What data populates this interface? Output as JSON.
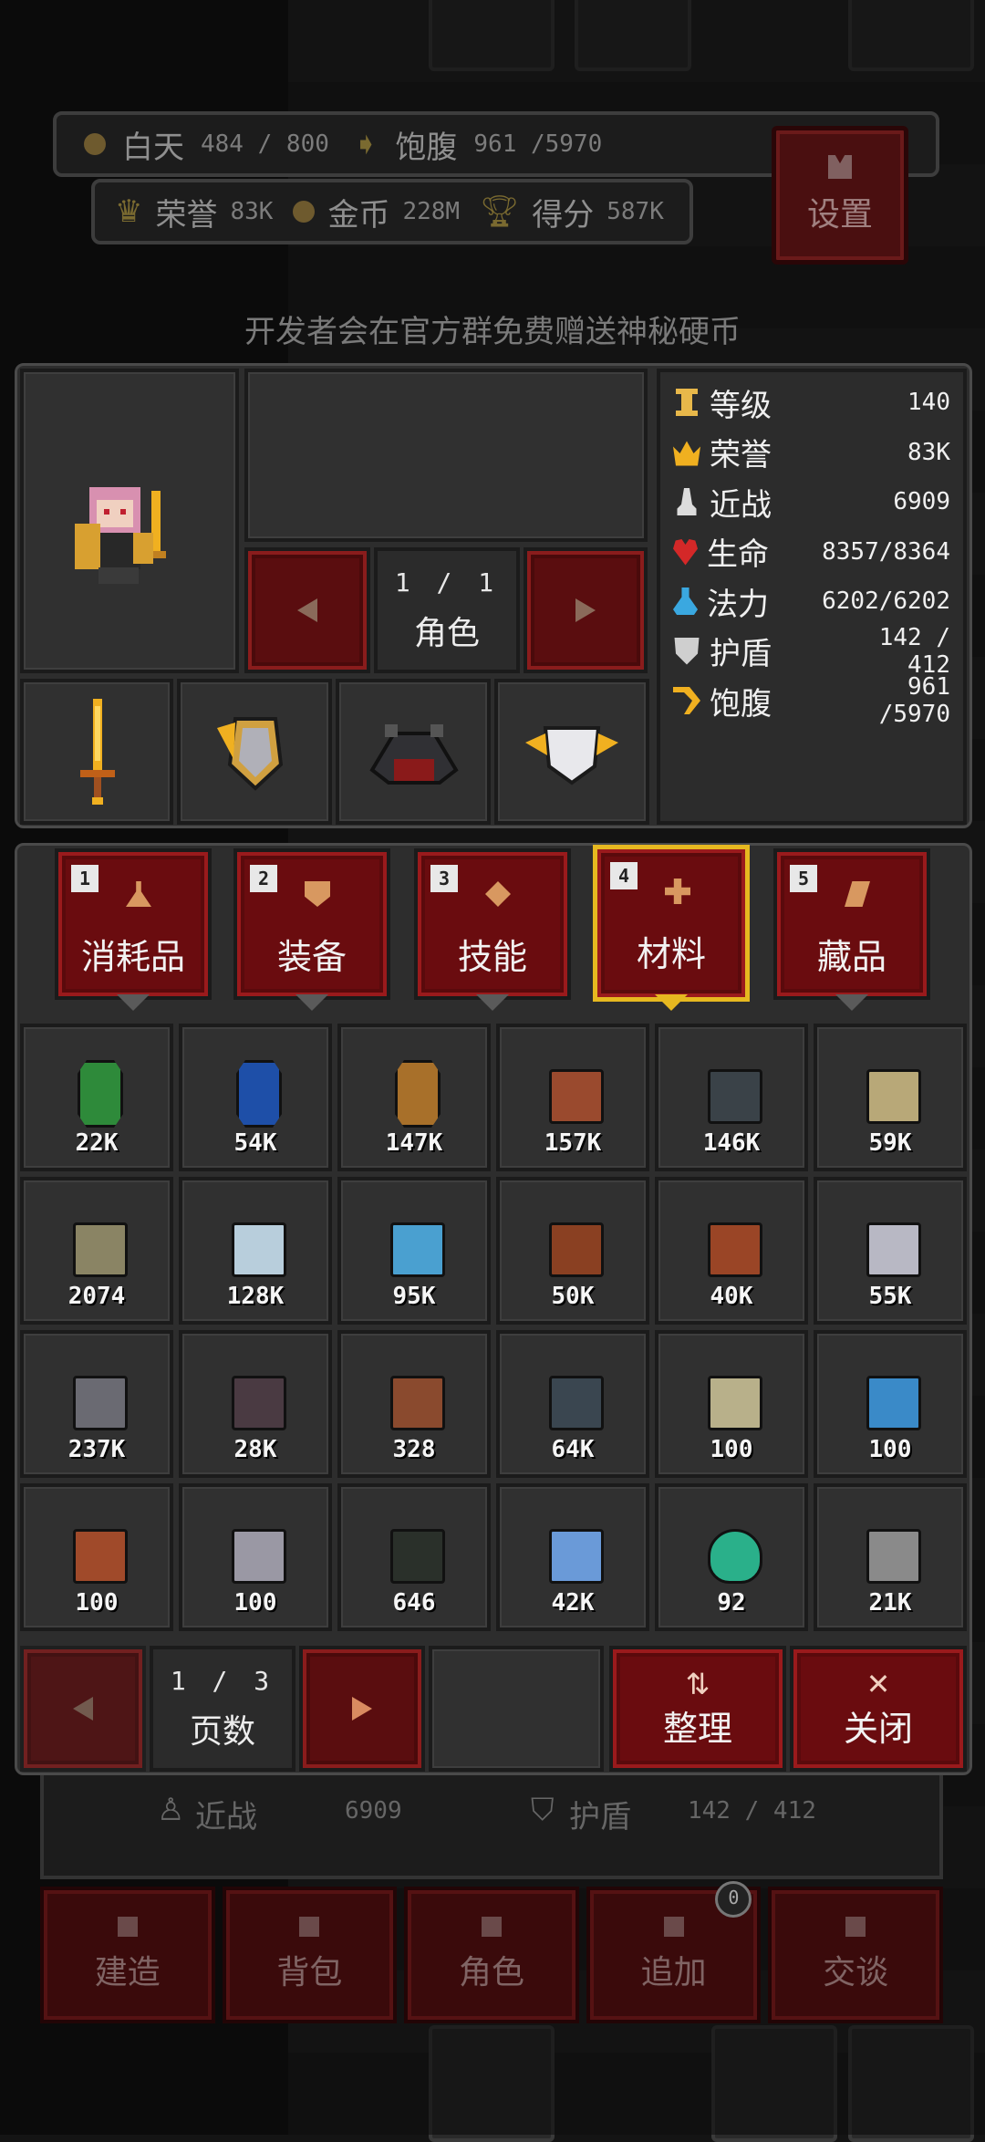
{
  "hud": {
    "day_label": "白天",
    "day_value": "484 / 800",
    "satiety_label": "饱腹",
    "satiety_value": "961 /5970",
    "honor_label": "荣誉",
    "honor_value": "83K",
    "gold_label": "金币",
    "gold_value": "228M",
    "score_label": "得分",
    "score_value": "587K",
    "settings_label": "设置"
  },
  "notice": "开发者会在官方群免费赠送神秘硬币",
  "character": {
    "page": "1 / 1",
    "page_label": "角色"
  },
  "stats": [
    {
      "label": "等级",
      "value": "140",
      "icon": "level-icon",
      "color": "#e8b84a"
    },
    {
      "label": "荣誉",
      "value": "83K",
      "icon": "crown-icon",
      "color": "#f0b020"
    },
    {
      "label": "近战",
      "value": "6909",
      "icon": "melee-icon",
      "color": "#dcdcdc"
    },
    {
      "label": "生命",
      "value": "8357/8364",
      "icon": "heart-icon",
      "color": "#d42828"
    },
    {
      "label": "法力",
      "value": "6202/6202",
      "icon": "mana-potion-icon",
      "color": "#3aa8e0"
    },
    {
      "label": "护盾",
      "value": "142 / 412",
      "icon": "shield-icon",
      "color": "#cfcfcf"
    },
    {
      "label": "饱腹",
      "value": "961 /5970",
      "icon": "satiety-icon",
      "color": "#f0b020"
    }
  ],
  "tabs": [
    {
      "num": "1",
      "label": "消耗品",
      "active": false
    },
    {
      "num": "2",
      "label": "装备",
      "active": false
    },
    {
      "num": "3",
      "label": "技能",
      "active": false
    },
    {
      "num": "4",
      "label": "材料",
      "active": true
    },
    {
      "num": "5",
      "label": "藏品",
      "active": false
    }
  ],
  "inventory": [
    {
      "count": "22K",
      "color": "#2e8a3a",
      "shape": "gem"
    },
    {
      "count": "54K",
      "color": "#1e4fa8",
      "shape": "gem"
    },
    {
      "count": "147K",
      "color": "#a8702a",
      "shape": "gem"
    },
    {
      "count": "157K",
      "color": "#9a4a2e",
      "shape": "block"
    },
    {
      "count": "146K",
      "color": "#3a4248",
      "shape": "block"
    },
    {
      "count": "59K",
      "color": "#b8a878",
      "shape": "block"
    },
    {
      "count": "2074",
      "color": "#8a8464",
      "shape": "block"
    },
    {
      "count": "128K",
      "color": "#b8cedc",
      "shape": "block"
    },
    {
      "count": "95K",
      "color": "#4aa0d0",
      "shape": "block"
    },
    {
      "count": "50K",
      "color": "#8a4022",
      "shape": "block"
    },
    {
      "count": "40K",
      "color": "#9a4526",
      "shape": "block"
    },
    {
      "count": "55K",
      "color": "#b8b8c4",
      "shape": "block"
    },
    {
      "count": "237K",
      "color": "#6a6a72",
      "shape": "block"
    },
    {
      "count": "28K",
      "color": "#4a3a42",
      "shape": "block"
    },
    {
      "count": "328",
      "color": "#8a4a2e",
      "shape": "block"
    },
    {
      "count": "64K",
      "color": "#3a4650",
      "shape": "block"
    },
    {
      "count": "100",
      "color": "#b8b08a",
      "shape": "block"
    },
    {
      "count": "100",
      "color": "#3a8ac8",
      "shape": "block"
    },
    {
      "count": "100",
      "color": "#a04a2a",
      "shape": "block"
    },
    {
      "count": "100",
      "color": "#9a98a4",
      "shape": "block"
    },
    {
      "count": "646",
      "color": "#2a302a",
      "shape": "block"
    },
    {
      "count": "42K",
      "color": "#6a9ad8",
      "shape": "block"
    },
    {
      "count": "92",
      "color": "#2ab08a",
      "shape": "potion"
    },
    {
      "count": "21K",
      "color": "#8a8a8a",
      "shape": "block"
    }
  ],
  "pager": {
    "page": "1 / 3",
    "label": "页数"
  },
  "actions": {
    "sort_label": "整理",
    "close_label": "关闭"
  },
  "under": {
    "melee_label": "近战",
    "melee_value": "6909",
    "shield_label": "护盾",
    "shield_value": "142 / 412"
  },
  "dock": [
    {
      "label": "建造",
      "badge": ""
    },
    {
      "label": "背包",
      "badge": ""
    },
    {
      "label": "角色",
      "badge": ""
    },
    {
      "label": "追加",
      "badge": "0"
    },
    {
      "label": "交谈",
      "badge": ""
    }
  ]
}
